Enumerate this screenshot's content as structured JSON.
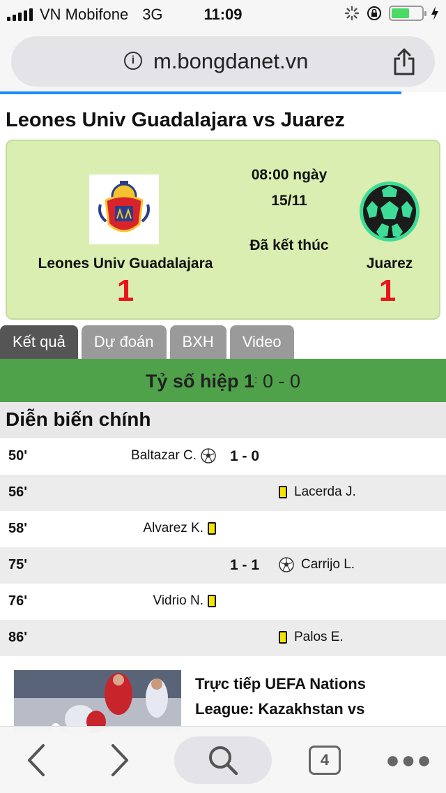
{
  "status_bar": {
    "carrier": "VN Mobifone",
    "network": "3G",
    "time": "11:09",
    "battery_level": 0.6
  },
  "browser": {
    "url": "m.bongdanet.vn",
    "open_tabs": "4",
    "load_progress": 0.9
  },
  "match": {
    "title": "Leones Univ Guadalajara vs Juarez",
    "home_team": "Leones Univ Guadalajara",
    "away_team": "Juarez",
    "home_score": "1",
    "away_score": "1",
    "kickoff_line1": "08:00 ngày",
    "kickoff_line2": "15/11",
    "status": "Đã kết thúc"
  },
  "tabs": [
    {
      "label": "Kết quả",
      "active": true
    },
    {
      "label": "Dự đoán",
      "active": false
    },
    {
      "label": "BXH",
      "active": false
    },
    {
      "label": "Video",
      "active": false
    }
  ],
  "half_time": {
    "label": "Tỷ số hiệp 1",
    "separator": ":",
    "score": "0 - 0"
  },
  "section_title": "Diễn biến chính",
  "events": [
    {
      "minute": "50'",
      "home_player": "Baltazar C.",
      "home_icon": "goal",
      "score": "1 - 0",
      "away_player": "",
      "away_icon": ""
    },
    {
      "minute": "56'",
      "home_player": "",
      "home_icon": "",
      "score": "",
      "away_player": "Lacerda J.",
      "away_icon": "yellow-card"
    },
    {
      "minute": "58'",
      "home_player": "Alvarez K.",
      "home_icon": "yellow-card",
      "score": "",
      "away_player": "",
      "away_icon": ""
    },
    {
      "minute": "75'",
      "home_player": "",
      "home_icon": "",
      "score": "1 - 1",
      "away_player": "Carrijo L.",
      "away_icon": "goal"
    },
    {
      "minute": "76'",
      "home_player": "Vidrio N.",
      "home_icon": "yellow-card",
      "score": "",
      "away_player": "",
      "away_icon": ""
    },
    {
      "minute": "86'",
      "home_player": "",
      "home_icon": "",
      "score": "",
      "away_player": "Palos E.",
      "away_icon": "yellow-card"
    }
  ],
  "news": {
    "headline": "Trực tiếp UEFA Nations League: Kazakhstan vs"
  },
  "colors": {
    "card_bg": "#d9eeb0",
    "score_red": "#e8141c",
    "half_bar_green": "#4fa24a",
    "progress_blue": "#1a8cff"
  }
}
